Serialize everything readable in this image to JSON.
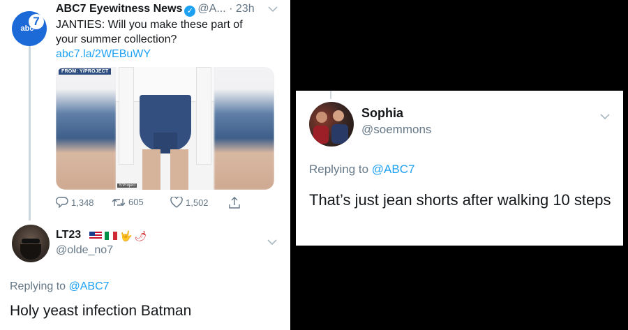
{
  "original_tweet": {
    "display_name": "ABC7 Eyewitness News",
    "handle": "@A...",
    "separator": "·",
    "time": "23h",
    "logo_text": "abc",
    "logo_number": "7",
    "text_main": "JANTIES: Will you make these part of your summer collection? ",
    "text_link": "abc7.la/2WEBuWY",
    "media": {
      "tag": "FROM: Y/PROJECT",
      "credit": "Y/Project"
    },
    "actions": {
      "replies": "1,348",
      "retweets": "605",
      "likes": "1,502"
    }
  },
  "reply_1": {
    "display_name": "LT23",
    "handle": "@olde_no7",
    "replying_to_label": "Replying to ",
    "replying_to_mention": "@ABC7",
    "emoji_hand": "🤟",
    "emoji_pepper": "🌶",
    "text": "Holy yeast infection Batman"
  },
  "reply_2": {
    "display_name": "Sophia",
    "handle": "@soemmons",
    "replying_to_label": "Replying to ",
    "replying_to_mention": "@ABC7",
    "text": "That’s just jean shorts after walking 10 steps"
  },
  "icons": {
    "verified": "verified-badge-icon",
    "chevron": "chevron-down-icon",
    "reply": "reply-icon",
    "retweet": "retweet-icon",
    "like": "heart-icon",
    "share": "share-icon"
  },
  "colors": {
    "link": "#1da1f2",
    "secondary_text": "#657786",
    "abc_blue": "#1b6ad8"
  }
}
